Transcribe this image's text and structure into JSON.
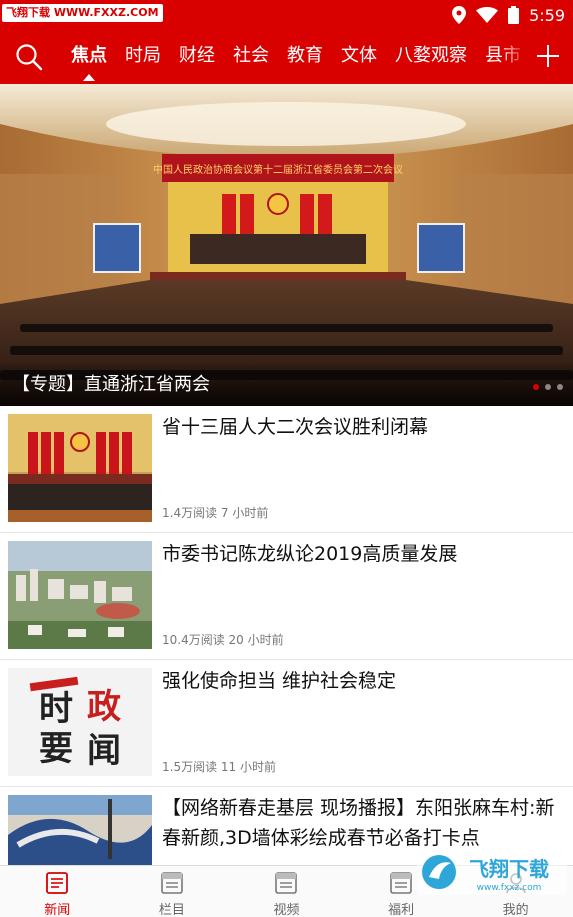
{
  "status_bar": {
    "watermark": "飞翔下载 WWW.FXXZ.COM",
    "time": "5:59",
    "icons": [
      "location-icon",
      "wifi-icon",
      "battery-icon"
    ]
  },
  "nav": {
    "search_icon": "search-icon",
    "tabs": [
      "焦点",
      "时局",
      "财经",
      "社会",
      "教育",
      "文体",
      "八婺观察",
      "县市"
    ],
    "active_tab": "焦点",
    "add_icon": "plus-icon"
  },
  "banner": {
    "caption": "【专题】直通浙江省两会",
    "image_banner_text": "中国人民政治协商会议第十二届浙江省委员会第二次会议",
    "dots": 3,
    "active_dot": 0
  },
  "news": [
    {
      "title": "省十三届人大二次会议胜利闭幕",
      "meta": "1.4万阅读 7 小时前",
      "thumb": "congress-hall-photo"
    },
    {
      "title": "市委书记陈龙纵论2019高质量发展",
      "meta": "10.4万阅读 20 小时前",
      "thumb": "city-aerial-photo"
    },
    {
      "title": "强化使命担当 维护社会稳定",
      "meta": "1.5万阅读 11 小时前",
      "thumb": "shizheng-yaowen-graphic",
      "thumb_text": [
        "时",
        "政",
        "要",
        "闻"
      ]
    },
    {
      "title": "【网络新春走基层 现场播报】东阳张麻车村:新春新颜,3D墙体彩绘成春节必备打卡点",
      "meta": "",
      "thumb": "mural-photo"
    }
  ],
  "tab_bar": {
    "items": [
      {
        "label": "新闻",
        "icon": "news-icon"
      },
      {
        "label": "栏目",
        "icon": "column-icon"
      },
      {
        "label": "视频",
        "icon": "video-icon"
      },
      {
        "label": "福利",
        "icon": "gift-icon"
      },
      {
        "label": "我的",
        "icon": "profile-icon"
      }
    ],
    "active": "新闻"
  },
  "corner_logo": {
    "text": "飞翔下载",
    "url_text": "www.fxxz.com"
  },
  "colors": {
    "brand_red": "#d90000",
    "meta_gray": "#777777"
  }
}
